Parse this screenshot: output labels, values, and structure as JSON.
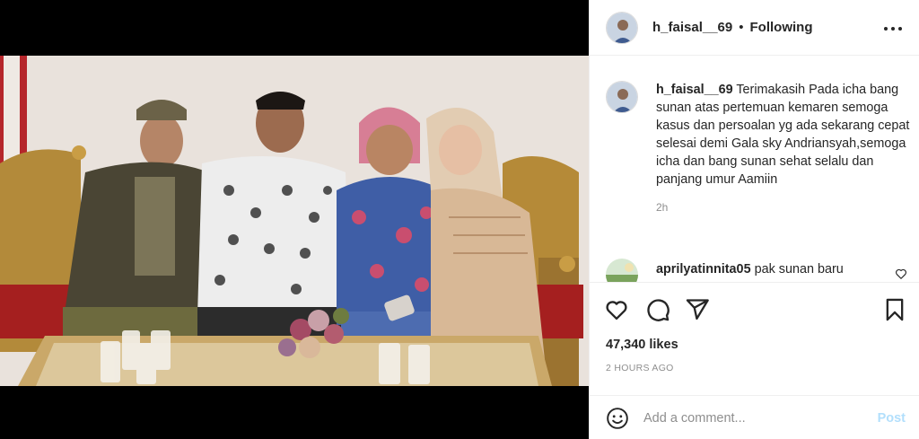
{
  "post": {
    "username": "h_faisal__69",
    "separator": "•",
    "follow_status": "Following",
    "more_icon": "more-horizontal-icon"
  },
  "caption": {
    "username": "h_faisal__69",
    "text": "Terimakasih Pada icha bang sunan atas pertemuan kemaren semoga kasus dan persoalan yg ada sekarang cepat selesai demi Gala sky Andriansyah,semoga icha dan bang sunan sehat selalu dan panjang umur Aamiin",
    "time": "2h"
  },
  "comments": [
    {
      "username": "aprilyatinnita05",
      "text": "pak sunan baru"
    }
  ],
  "actions": {
    "like_icon": "heart-icon",
    "comment_icon": "comment-icon",
    "share_icon": "send-icon",
    "save_icon": "bookmark-icon"
  },
  "likes": "47,340 likes",
  "time_ago": "2 HOURS AGO",
  "add_comment": {
    "placeholder": "Add a comment...",
    "post_label": "Post",
    "emoji_icon": "emoji-icon"
  },
  "colors": {
    "text": "#262626",
    "muted": "#8e8e8e",
    "post_disabled": "#b2dffc",
    "border": "#efefef"
  }
}
